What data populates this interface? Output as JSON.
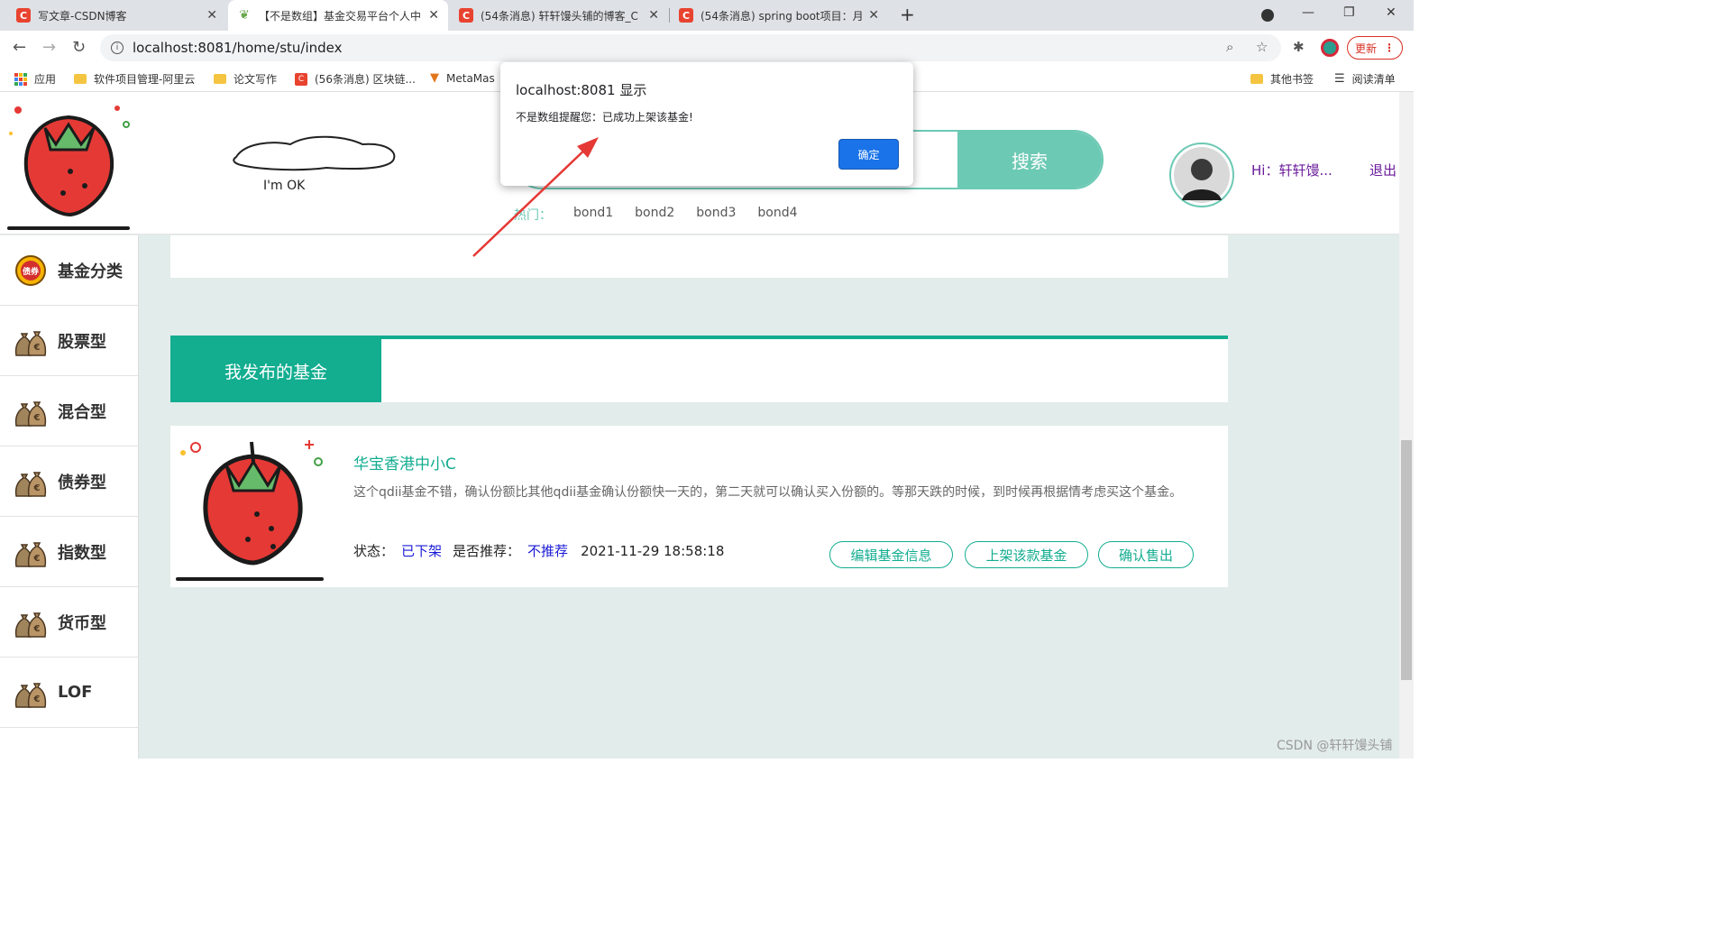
{
  "browser": {
    "tabs": [
      {
        "title": "写文章-CSDN博客",
        "icon": "csdn"
      },
      {
        "title": "【不是数组】基金交易平台个人中",
        "icon": "leaf"
      },
      {
        "title": "(54条消息) 轩轩馒头铺的博客_C",
        "icon": "csdn"
      },
      {
        "title": "(54条消息) spring boot项目：月",
        "icon": "csdn"
      }
    ],
    "url": "localhost:8081/home/stu/index",
    "update_label": "更新",
    "bookmarks": [
      {
        "label": "应用",
        "type": "apps"
      },
      {
        "label": "软件项目管理-阿里云",
        "type": "folder"
      },
      {
        "label": "论文写作",
        "type": "folder"
      },
      {
        "label": "(56条消息) 区块链...",
        "type": "csdn"
      },
      {
        "label": "MetaMas",
        "type": "fox"
      }
    ],
    "bookmarks_right": [
      {
        "label": "其他书签"
      },
      {
        "label": "阅读清单"
      }
    ]
  },
  "header": {
    "search_button": "搜索",
    "hot_label": "热门：",
    "hot_items": [
      "bond1",
      "bond2",
      "bond3",
      "bond4"
    ],
    "greeting": "Hi：轩轩馒...",
    "logout": "退出",
    "ok_text": "I'm  OK"
  },
  "sidebar": {
    "items": [
      {
        "label": "基金分类",
        "icon": "bond-badge-icon"
      },
      {
        "label": "股票型",
        "icon": "money-bag-icon"
      },
      {
        "label": "混合型",
        "icon": "money-bag-icon"
      },
      {
        "label": "债券型",
        "icon": "money-bag-icon"
      },
      {
        "label": "指数型",
        "icon": "money-bag-icon"
      },
      {
        "label": "货币型",
        "icon": "money-bag-icon"
      },
      {
        "label": "LOF",
        "icon": "money-bag-icon"
      }
    ],
    "badge_text": "债券"
  },
  "main": {
    "section_title": "我发布的基金",
    "fund": {
      "name": "华宝香港中小C",
      "description": "这个qdii基金不错，确认份额比其他qdii基金确认份额快一天的，第二天就可以确认买入份额的。等那天跌的时候，到时候再根据情考虑买这个基金。",
      "status_label": "状态：",
      "status_value": "已下架",
      "recommend_label": "是否推荐：",
      "recommend_value": "不推荐",
      "time": "2021-11-29 18:58:18",
      "actions": [
        "编辑基金信息",
        "上架该款基金",
        "确认售出"
      ]
    }
  },
  "dialog": {
    "title": "localhost:8081 显示",
    "message": "不是数组提醒您：已成功上架该基金!",
    "ok": "确定"
  },
  "watermark": "CSDN @轩轩馒头铺",
  "colors": {
    "accent": "#13ad90",
    "search": "#6cc9b4",
    "dialog_button": "#1a73e8",
    "arrow": "#e53935"
  }
}
